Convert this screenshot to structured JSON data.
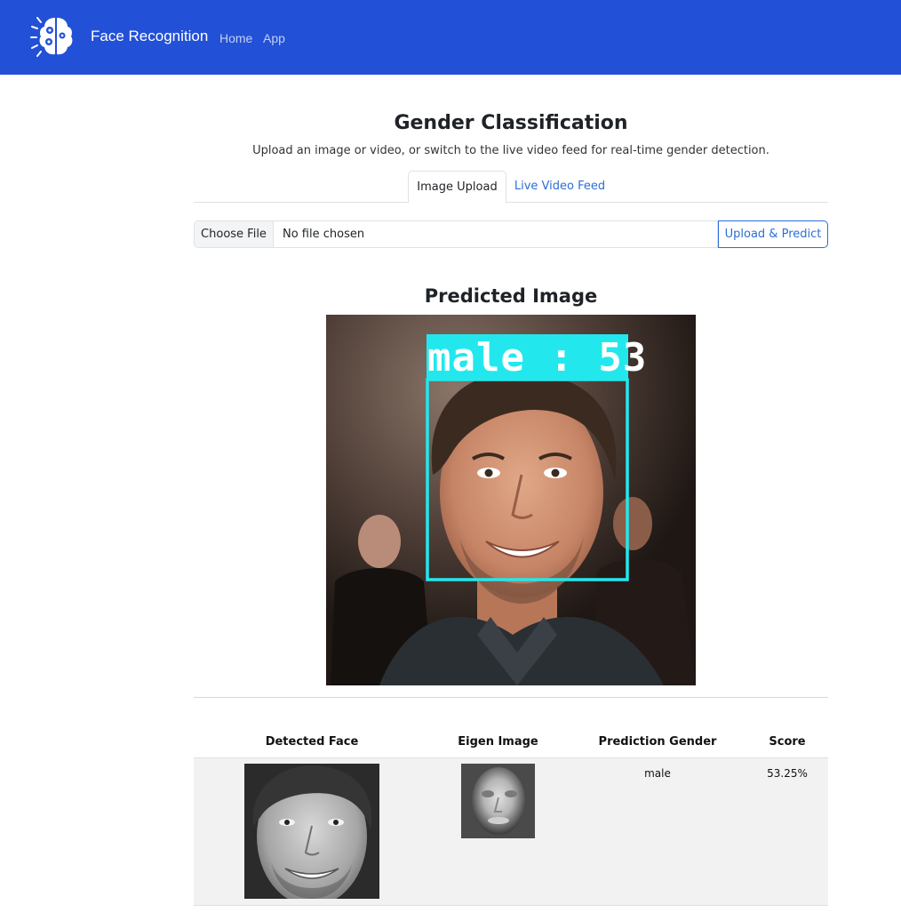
{
  "navbar": {
    "brand": "Face Recognition",
    "logo_icon": "brain-gear-icon",
    "links": [
      {
        "label": "Home"
      },
      {
        "label": "App"
      }
    ],
    "bg_color": "#2250d6"
  },
  "main": {
    "title": "Gender Classification",
    "subtitle": "Upload an image or video, or switch to the live video feed for real-time gender detection.",
    "tabs": [
      {
        "label": "Image Upload",
        "active": true
      },
      {
        "label": "Live Video Feed",
        "active": false
      }
    ],
    "file_input": {
      "button_label": "Choose File",
      "value": "No file chosen"
    },
    "upload_button": "Upload & Predict",
    "predicted_title": "Predicted Image",
    "overlay_label": "male : 53",
    "box_color": "#22e8ee"
  },
  "results": {
    "headers": [
      "Detected Face",
      "Eigen Image",
      "Prediction Gender",
      "Score"
    ],
    "rows": [
      {
        "gender": "male",
        "score": "53.25%"
      }
    ]
  }
}
